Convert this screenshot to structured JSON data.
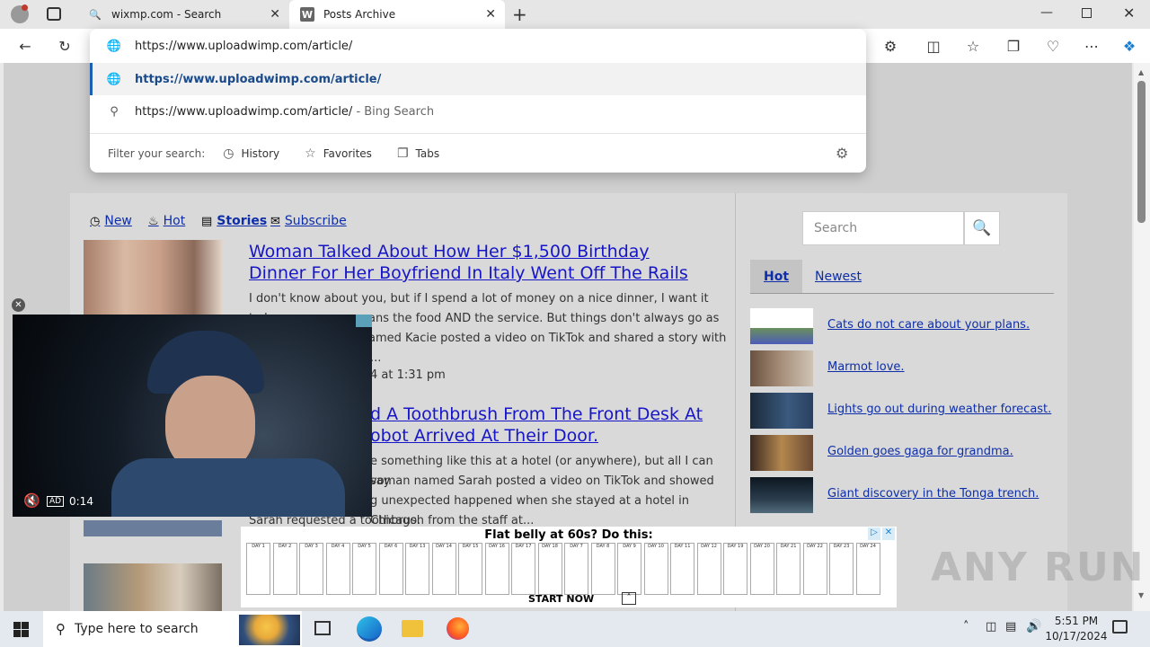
{
  "browser": {
    "tabs": [
      {
        "title": "wixmp.com - Search",
        "icon": "search-icon"
      },
      {
        "title": "Posts Archive",
        "icon": "w-logo"
      }
    ],
    "address": "https://www.uploadwimp.com/article/",
    "suggestions": [
      {
        "text": "https://www.uploadwimp.com/article/",
        "suffix": ""
      },
      {
        "text": "https://www.uploadwimp.com/article/",
        "suffix": " - Bing Search"
      }
    ],
    "filter": {
      "label": "Filter your search:",
      "chips": [
        "History",
        "Favorites",
        "Tabs"
      ]
    }
  },
  "nav": {
    "items": [
      "New",
      "Hot",
      "Stories",
      "Subscribe"
    ]
  },
  "posts": [
    {
      "title": "Woman Talked About How Her $1,500 Birthday Dinner For Her Boyfriend In Italy Went Off The Rails",
      "excerpt": "I don't know about you, but if I spend a lot of money on a nice dinner, I want it to be",
      "excerpt2": "ans the food AND the service. But things don't always go as",
      "excerpt3": "amed Kacie posted a video on TikTok and shared a story with",
      "excerpt4": "...",
      "meta": "4 at 1:31 pm"
    },
    {
      "title_l1": "d A Toothbrush From The Front Desk At",
      "title_l2": "obot Arrived At Their Door.",
      "excerpt1": "e something like this at a hotel (or anywhere), but all I can say",
      "excerpt2": "voman named Sarah posted a video on TikTok and showed",
      "excerpt3": "g unexpected happened when she stayed at a hotel in Chicago.",
      "excerpt4": "Sarah requested a toothbrush from the staff at..."
    }
  ],
  "sidebar": {
    "search_placeholder": "Search",
    "tab_hot": "Hot",
    "tab_newest": "Newest",
    "items": [
      "Cats do not care about your plans.",
      "Marmot love.",
      "Lights go out during weather forecast.",
      "Golden goes gaga for grandma.",
      "Giant discovery in the Tonga trench."
    ]
  },
  "video": {
    "time": "0:14",
    "ad_badge": "AD"
  },
  "ad": {
    "headline": "Flat belly at 60s? Do this:",
    "days": [
      "DAY 1",
      "DAY 2",
      "DAY 3",
      "DAY 4",
      "DAY 5",
      "DAY 6",
      "DAY 13",
      "DAY 14",
      "DAY 15",
      "DAY 16",
      "DAY 17",
      "DAY 18",
      "DAY 7",
      "DAY 8",
      "DAY 9",
      "DAY 10",
      "DAY 11",
      "DAY 12",
      "DAY 19",
      "DAY 20",
      "DAY 21",
      "DAY 22",
      "DAY 23",
      "DAY 24"
    ],
    "cta": "START NOW"
  },
  "taskbar": {
    "search_placeholder": "Type here to search",
    "time": "5:51 PM",
    "date": "10/17/2024"
  },
  "watermark": "ANY RUN"
}
